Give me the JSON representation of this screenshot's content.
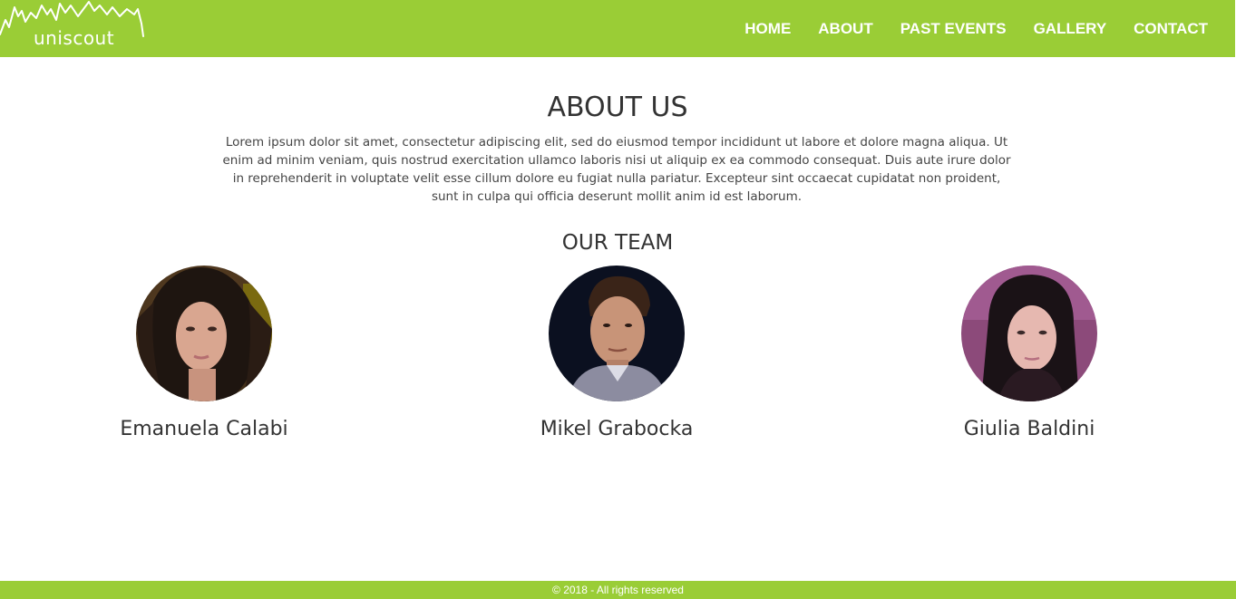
{
  "brand": {
    "name": "uniscout",
    "color": "#9acd36"
  },
  "nav": {
    "items": [
      {
        "label": "HOME"
      },
      {
        "label": "ABOUT"
      },
      {
        "label": "PAST EVENTS"
      },
      {
        "label": "GALLERY"
      },
      {
        "label": "CONTACT"
      }
    ]
  },
  "about": {
    "title": "ABOUT US",
    "text": "Lorem ipsum dolor sit amet, consectetur adipiscing elit, sed do eiusmod tempor incididunt ut labore et dolore magna aliqua. Ut enim ad minim veniam, quis nostrud exercitation ullamco laboris nisi ut aliquip ex ea commodo consequat. Duis aute irure dolor in reprehenderit in voluptate velit esse cillum dolore eu fugiat nulla pariatur. Excepteur sint occaecat cupidatat non proident, sunt in culpa qui officia deserunt mollit anim id est laborum."
  },
  "team": {
    "title": "OUR TEAM",
    "members": [
      {
        "name": "Emanuela Calabi"
      },
      {
        "name": "Mikel Grabocka"
      },
      {
        "name": "Giulia Baldini"
      }
    ]
  },
  "footer": {
    "text": "© 2018 - All rights reserved"
  }
}
